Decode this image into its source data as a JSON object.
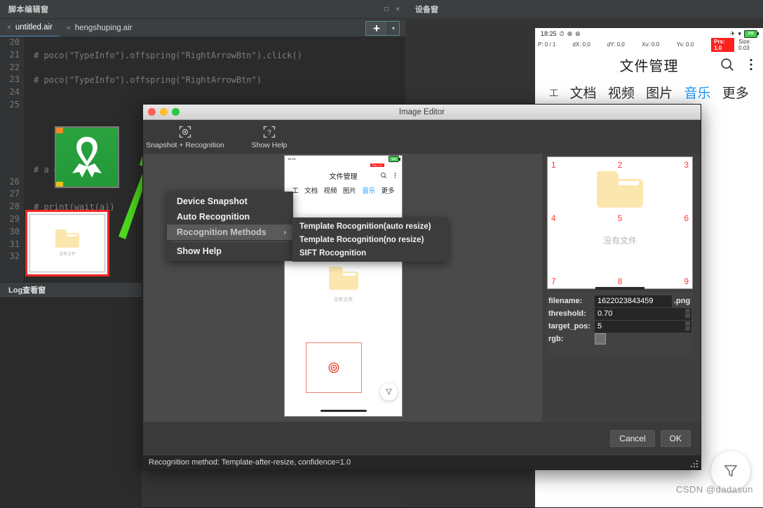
{
  "script_window": {
    "title": "脚本编辑窗",
    "window_buttons": [
      "□",
      "×"
    ],
    "tabs": [
      {
        "label": "untitled.air",
        "close": "×",
        "active": true
      },
      {
        "label": "hengshuping.air",
        "close": "×",
        "active": false
      }
    ],
    "add_button": {
      "plus": "+",
      "caret": "▾"
    },
    "code_lines": [
      {
        "num": "20",
        "text": ""
      },
      {
        "num": "21",
        "text": "# poco(\"TypeInfo\").offspring(\"RightArrowBtn\").click()"
      },
      {
        "num": "22",
        "text": ""
      },
      {
        "num": "23",
        "text": "# poco(\"TypeInfo\").offspring(\"RightArrowBtn\")"
      },
      {
        "num": "24",
        "text": ""
      },
      {
        "num": "25",
        "text": ""
      },
      {
        "num": "",
        "text": "# a ="
      },
      {
        "num": "26",
        "text": ""
      },
      {
        "num": "27",
        "text": ""
      },
      {
        "num": "28",
        "text": "# print(wait(a))"
      },
      {
        "num": "29",
        "text": ""
      },
      {
        "num": "30",
        "text": ""
      },
      {
        "num": "31",
        "text": ""
      },
      {
        "num": "32",
        "text": ""
      }
    ],
    "inline_thumb_caption": "没有文件",
    "log_panel_title": "Log查看窗"
  },
  "device_window": {
    "title": "设备窗",
    "status_bar": {
      "time": "18:25",
      "icons": [
        "alarm-icon",
        "mute-icon",
        "rotation-lock-icon"
      ],
      "right_icons": [
        "airplane-icon",
        "wifi-icon"
      ],
      "battery_label": "100"
    },
    "debug_row": {
      "pointer": "P: 0 / 1",
      "dx": "dX: 0.0",
      "dy": "dY: 0.0",
      "xv": "Xv: 0.0",
      "yv": "Yv: 0.0",
      "prs": "Prs: 1.0",
      "size": "Size: 0.03"
    },
    "app_title": "文件管理",
    "title_actions": [
      "search-icon",
      "more-vertical-icon"
    ],
    "tabs": [
      {
        "label": "工",
        "selected": false,
        "small": true
      },
      {
        "label": "文档",
        "selected": false
      },
      {
        "label": "视频",
        "selected": false
      },
      {
        "label": "图片",
        "selected": false
      },
      {
        "label": "音乐",
        "selected": true
      },
      {
        "label": "更多",
        "selected": false
      }
    ],
    "fab_icon": "filter-icon"
  },
  "image_editor": {
    "title": "Image Editor",
    "traffic_lights": [
      "close",
      "minimize",
      "zoom"
    ],
    "toolbar": [
      {
        "label": "Snapshot + Recognition",
        "icon": "snapshot-target-icon"
      },
      {
        "label": "Show Help",
        "icon": "help-question-icon"
      }
    ],
    "screenshot_preview": {
      "status_time": "18:24",
      "battery_label": "100",
      "debug_prs": "Prs: 1.0",
      "app_title": "文件管理",
      "tabs": [
        "工",
        "文档",
        "视频",
        "图片",
        "音乐",
        "更多"
      ],
      "selected_tab": "音乐",
      "empty_text": "没有文件"
    },
    "grid_preview": {
      "numbers": [
        "1",
        "2",
        "3",
        "4",
        "5",
        "6",
        "7",
        "8",
        "9"
      ],
      "empty_text": "没有文件",
      "number_color": "#ff3b30"
    },
    "properties": [
      {
        "key": "filename:",
        "value": "1622023843459",
        "suffix": ".png",
        "type": "text"
      },
      {
        "key": "threshold:",
        "value": "0.70",
        "suffix": "",
        "type": "spin"
      },
      {
        "key": "target_pos:",
        "value": "5",
        "suffix": "",
        "type": "spin"
      },
      {
        "key": "rgb:",
        "value": "",
        "suffix": "",
        "type": "color"
      }
    ],
    "buttons": {
      "cancel": "Cancel",
      "ok": "OK"
    },
    "status_text": "Recognition method: Template-after-resize, confidence=1.0"
  },
  "context_menu": {
    "items": [
      {
        "label": "Device Snapshot",
        "highlighted": false,
        "has_submenu": false
      },
      {
        "label": "Auto Recognition",
        "highlighted": false,
        "has_submenu": false
      },
      {
        "label": "Rocognition Methods",
        "highlighted": true,
        "has_submenu": true,
        "arrow": "›"
      },
      {
        "label": "Show Help",
        "highlighted": false,
        "has_submenu": false
      }
    ],
    "submenu": [
      {
        "label": "Template Rocognition(auto resize)"
      },
      {
        "label": "Template Rocognition(no resize)"
      },
      {
        "label": "SIFT Rocognition"
      }
    ]
  },
  "watermark": "CSDN @dadasun"
}
